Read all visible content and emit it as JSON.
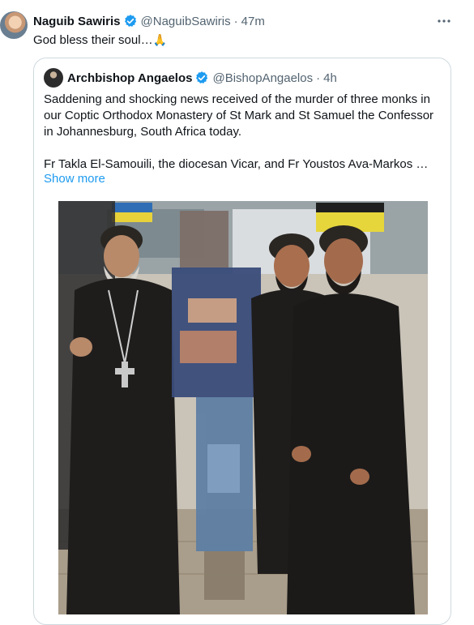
{
  "tweet": {
    "author_name": "Naguib Sawiris",
    "author_handle": "@NaguibSawiris",
    "separator": "·",
    "time": "47m",
    "text": "God bless their soul…",
    "emoji": "🙏",
    "more_icon": "more-horizontal-icon"
  },
  "quote": {
    "author_name": "Archbishop Angaelos",
    "author_handle": "@BishopAngaelos",
    "separator": "·",
    "time": "4h",
    "paragraph1": "Saddening and shocking news received of the murder of three monks in our Coptic Orthodox Monastery of St Mark and St Samuel the Confessor in Johannesburg, South Africa today.",
    "paragraph2": "Fr Takla El-Samouili, the diocesan Vicar, and Fr Youstos Ava-Markos …",
    "show_more": "Show more"
  },
  "colors": {
    "link": "#1d9bf0",
    "secondary_text": "#536471",
    "border": "#cfd9de",
    "verified": "#1d9bf0"
  }
}
